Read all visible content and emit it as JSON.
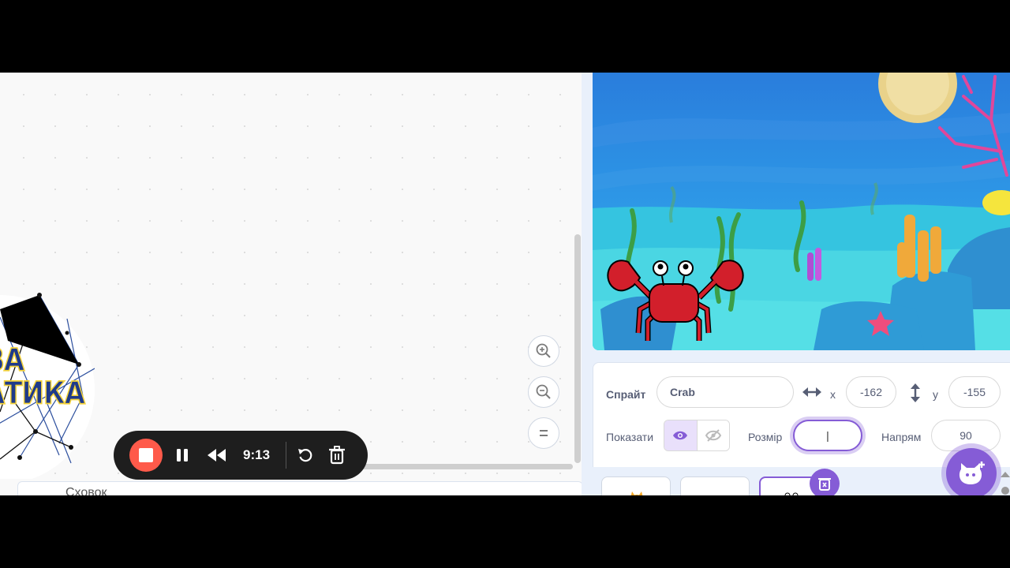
{
  "workspace": {
    "zoom_in_icon": "zoom-in-icon",
    "zoom_out_icon": "zoom-out-icon",
    "zoom_reset_icon": "zoom-reset-icon",
    "backpack_label": "Сховок"
  },
  "sprite_info": {
    "sprite_label": "Спрайт",
    "sprite_name": "Crab",
    "x_label": "x",
    "x_value": "-162",
    "y_label": "y",
    "y_value": "-155",
    "show_label": "Показати",
    "size_label": "Розмір",
    "size_value": "|",
    "direction_label": "Напрям",
    "direction_value": "90"
  },
  "recorder": {
    "time": "9:13"
  },
  "logo": {
    "line1": "ВА",
    "line2": "АТИКА"
  },
  "colors": {
    "accent": "#855cd6",
    "stop_red": "#ff5a4a",
    "recorder_bg": "#1e1e1e"
  }
}
